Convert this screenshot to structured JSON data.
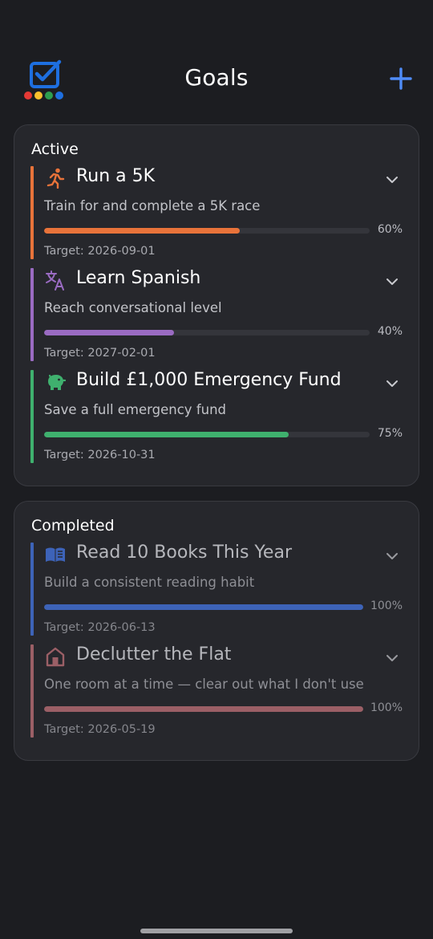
{
  "header": {
    "title": "Goals",
    "add_icon": "plus-icon",
    "logo_icon": "checkbox-logo-icon",
    "colors": {
      "accent": "#4f8cf7",
      "logo_dots": [
        "#e53935",
        "#fbc02d",
        "#2e9e4f",
        "#1e6fe0"
      ]
    }
  },
  "sections": {
    "active": {
      "title": "Active",
      "goals": [
        {
          "icon": "running-icon",
          "title": "Run a 5K",
          "description": "Train for and complete a 5K race",
          "progress": 60,
          "progress_label": "60%",
          "target": "Target: 2026-09-01",
          "color": "#e8733a"
        },
        {
          "icon": "translate-icon",
          "title": "Learn Spanish",
          "description": "Reach conversational level",
          "progress": 40,
          "progress_label": "40%",
          "target": "Target: 2027-02-01",
          "color": "#9a6bc2"
        },
        {
          "icon": "piggy-bank-icon",
          "title": "Build £1,000 Emergency Fund",
          "description": "Save a full emergency fund",
          "progress": 75,
          "progress_label": "75%",
          "target": "Target: 2026-10-31",
          "color": "#3fb06e"
        }
      ]
    },
    "completed": {
      "title": "Completed",
      "goals": [
        {
          "icon": "book-icon",
          "title": "Read 10 Books This Year",
          "description": "Build a consistent reading habit",
          "progress": 100,
          "progress_label": "100%",
          "target": "Target: 2026-06-13",
          "color": "#3d63b8"
        },
        {
          "icon": "home-icon",
          "title": "Declutter the Flat",
          "description": "One room at a time — clear out what I don't use",
          "progress": 100,
          "progress_label": "100%",
          "target": "Target: 2026-05-19",
          "color": "#9b5f66"
        }
      ]
    }
  }
}
